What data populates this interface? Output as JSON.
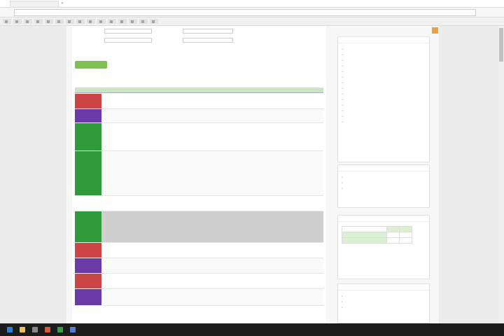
{
  "browser": {
    "tab_title": "",
    "close_glyph": "×",
    "bookmarks": [
      {
        "label": ""
      },
      {
        "label": ""
      },
      {
        "label": ""
      },
      {
        "label": ""
      },
      {
        "label": ""
      },
      {
        "label": ""
      },
      {
        "label": ""
      },
      {
        "label": ""
      },
      {
        "label": ""
      },
      {
        "label": ""
      },
      {
        "label": ""
      },
      {
        "label": ""
      },
      {
        "label": ""
      },
      {
        "label": ""
      },
      {
        "label": ""
      }
    ]
  },
  "form": {
    "label1": "",
    "label2": "",
    "label3": "",
    "label4": "",
    "hint": "",
    "hint_link": "",
    "submit_label": ""
  },
  "table": {
    "headers": [
      "",
      "",
      "",
      ""
    ],
    "rows": [
      {
        "status_color": "#cc4444",
        "status": "",
        "desc": "",
        "desc_link": "",
        "by": "",
        "by_link": "",
        "date": ""
      },
      {
        "status_color": "#6a3aa6",
        "status": "",
        "desc": "",
        "desc_link": "",
        "by": "",
        "by_link": "",
        "date": ""
      },
      {
        "status_color": "#2e9a3a",
        "status": "",
        "desc": "",
        "desc_link": "",
        "by": "",
        "by_link": "",
        "date": ""
      },
      {
        "status_color": "#2e9a3a",
        "status": "",
        "desc": "",
        "desc_link": "",
        "by": "",
        "by_link": "",
        "date": ""
      },
      {
        "status_color": "#ffffff",
        "status": "",
        "desc": "",
        "desc_link": "",
        "by": "",
        "by_link": "",
        "date": ""
      },
      {
        "status_color": "#2e9a3a",
        "status": "",
        "desc": "",
        "desc_link": "",
        "by": "",
        "by_link": "",
        "date": ""
      },
      {
        "status_color": "#cc4444",
        "status": "",
        "desc": "",
        "desc_link": "",
        "by": "",
        "by_link": "",
        "date": ""
      },
      {
        "status_color": "#6a3aa6",
        "status": "",
        "desc": "",
        "desc_link": "",
        "by": "",
        "by_link": "",
        "date": ""
      },
      {
        "status_color": "#cc4444",
        "status": "",
        "desc": "",
        "desc_link": "",
        "by": "",
        "by_link": "",
        "date": ""
      },
      {
        "status_color": "#6a3aa6",
        "status": "",
        "desc": "",
        "desc_link": "",
        "by": "",
        "by_link": "",
        "date": ""
      }
    ],
    "note": ""
  },
  "sidebar": {
    "box1": {
      "title": "",
      "items": [
        "",
        "",
        "",
        "",
        "",
        "",
        "",
        "",
        "",
        "",
        "",
        "",
        "",
        ""
      ],
      "more": ""
    },
    "box2": {
      "title": "",
      "items": [
        "",
        "",
        ""
      ]
    },
    "box3": {
      "title": "",
      "links": [
        "",
        "",
        ""
      ]
    },
    "box4": {
      "title": "",
      "items": [
        "",
        "",
        ""
      ]
    }
  },
  "taskbar": {
    "time": "",
    "date": ""
  },
  "colors": {
    "accent_green": "#7cc04e",
    "status_red": "#cc4444",
    "status_purple": "#6a3aa6",
    "status_green": "#2e9a3a",
    "link": "#3355cc"
  }
}
